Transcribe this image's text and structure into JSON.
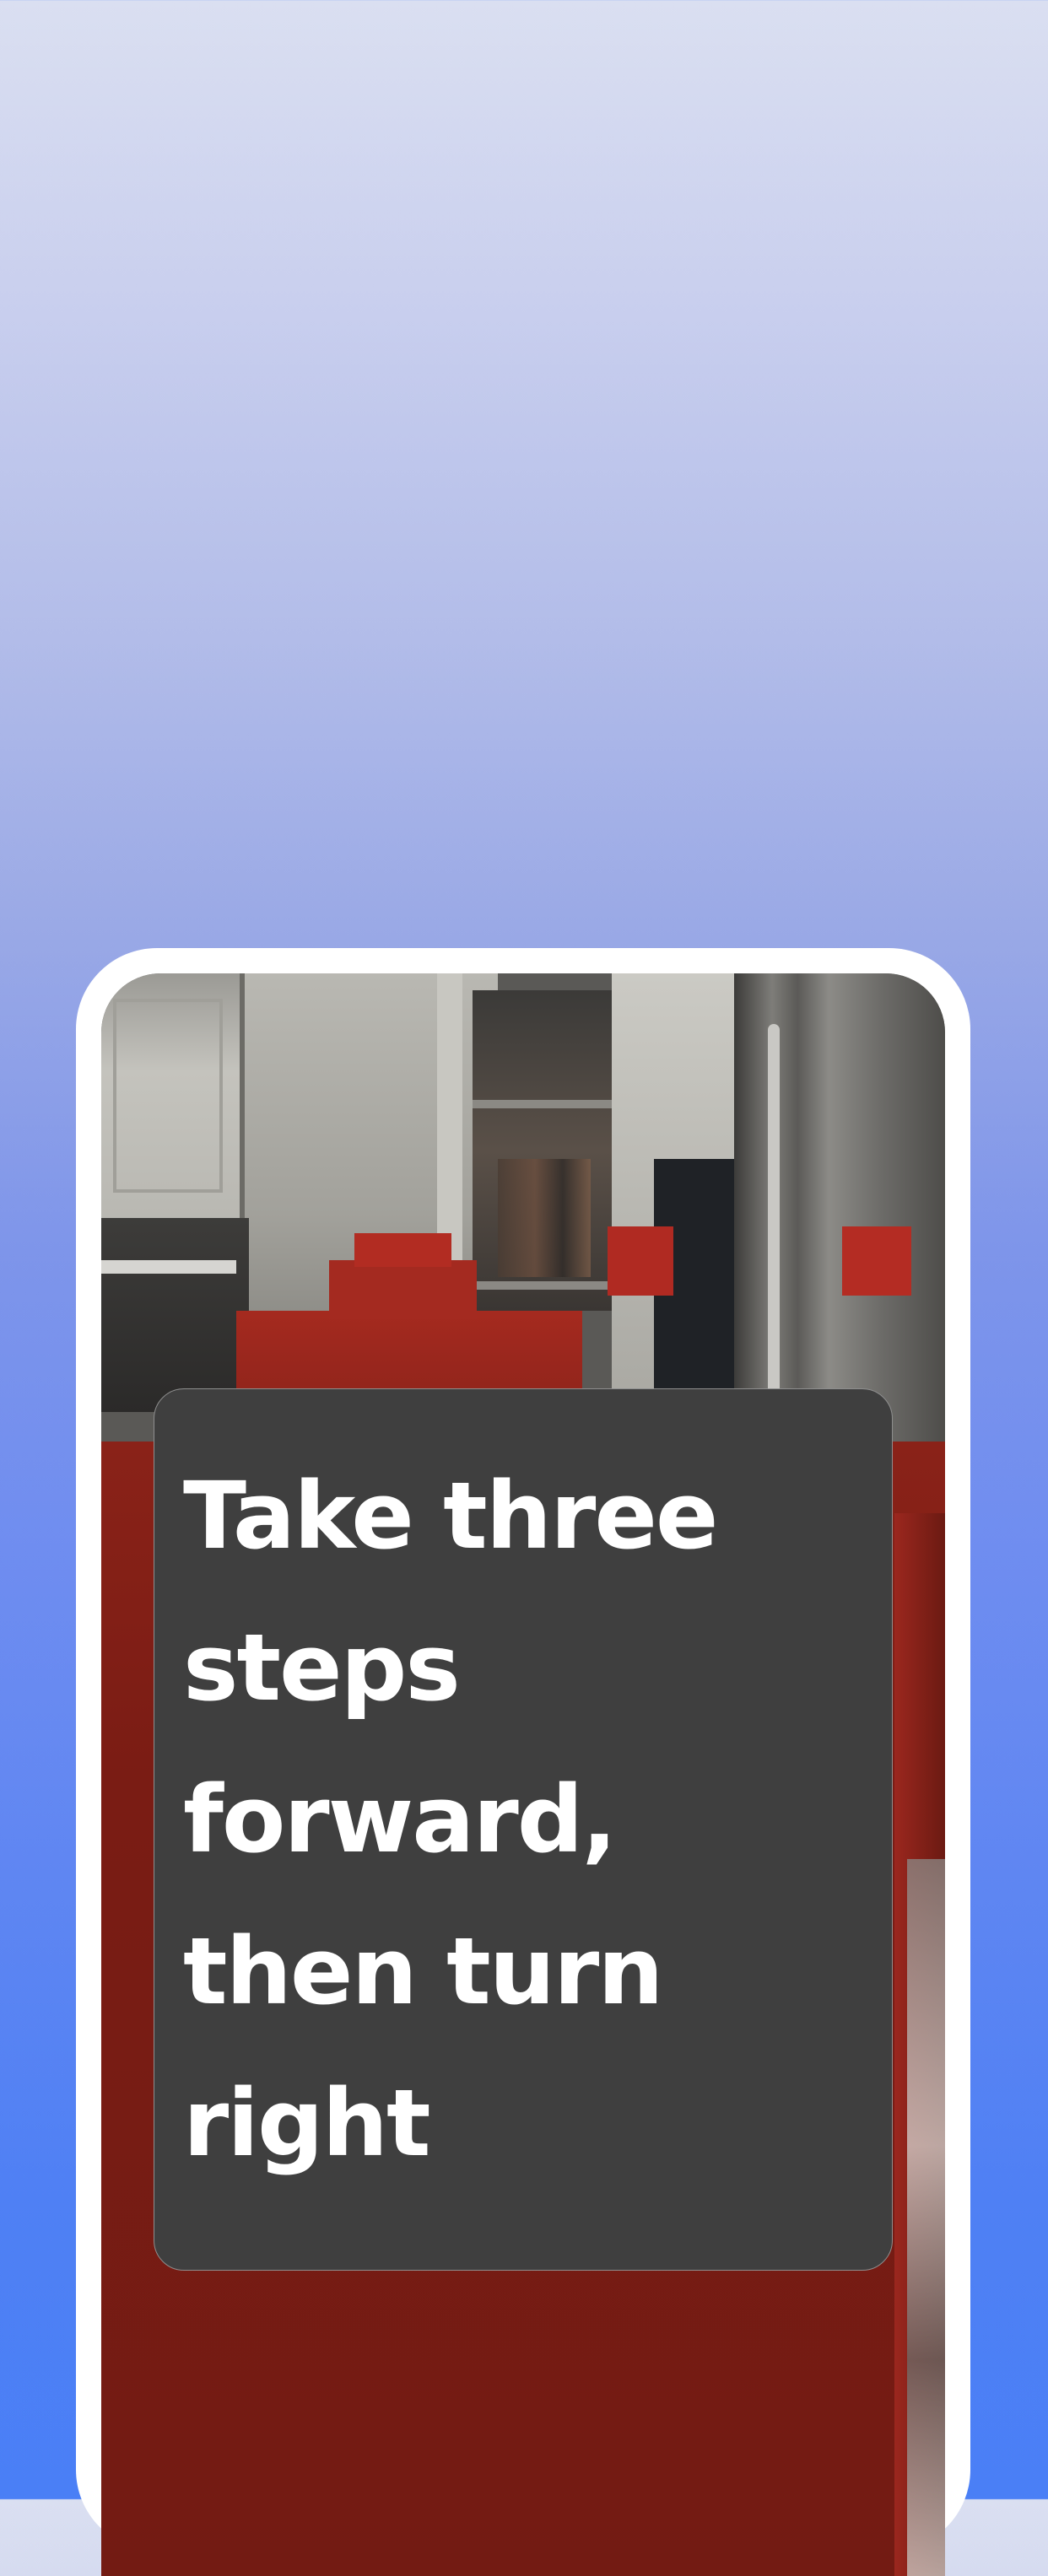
{
  "instruction": {
    "text": "Take three steps forward, then turn right"
  },
  "colors": {
    "background_top": "#dadff1",
    "background_bottom": "#4a7ff6",
    "phone_frame": "#ffffff",
    "card_background": "#3f3f3f",
    "card_text": "#ffffff",
    "ar_block_red": "#a42a20"
  },
  "camera_view": {
    "description_icon": "camera-feed"
  }
}
